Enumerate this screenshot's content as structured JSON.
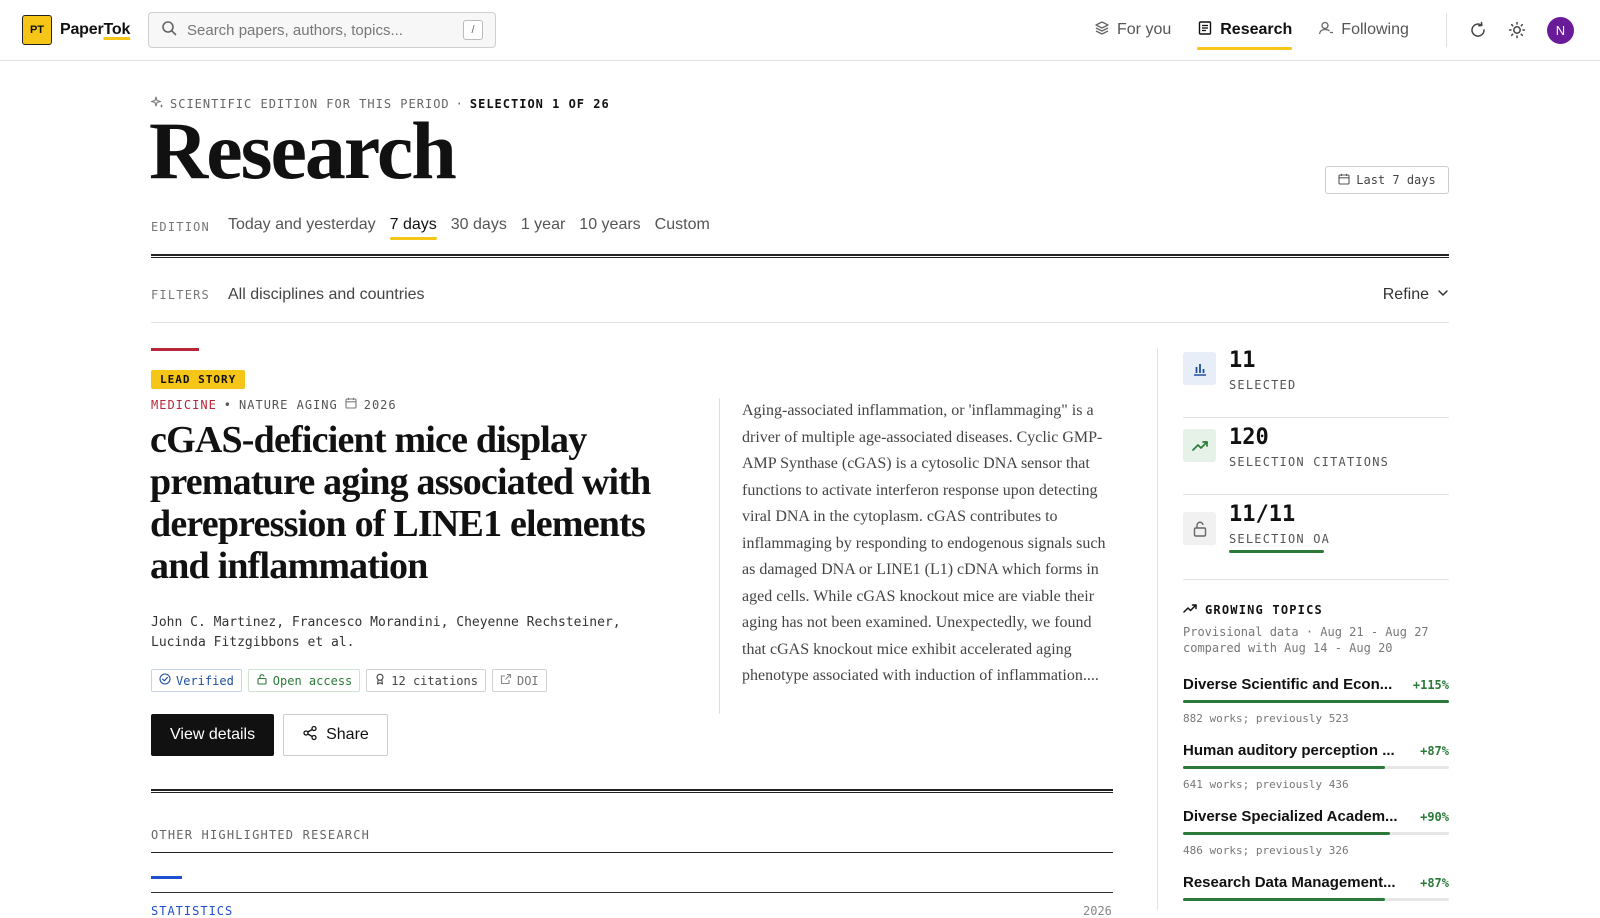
{
  "brand": {
    "badge": "PT",
    "name_a": "Paper",
    "name_b": "Tok"
  },
  "search": {
    "placeholder": "Search papers, authors, topics...",
    "shortcut": "/"
  },
  "nav": [
    {
      "label": "For you",
      "icon": "layers-icon",
      "active": false
    },
    {
      "label": "Research",
      "icon": "newspaper-icon",
      "active": true
    },
    {
      "label": "Following",
      "icon": "user-icon",
      "active": false
    }
  ],
  "user": {
    "initial": "N",
    "color": "#6a1b9a"
  },
  "edition": {
    "kicker": "SCIENTIFIC EDITION FOR THIS PERIOD",
    "separator": "·",
    "selection": "SELECTION 1 OF 26",
    "title": "Research",
    "range_button": "Last 7 days",
    "label": "EDITION",
    "options": [
      "Today and yesterday",
      "7 days",
      "30 days",
      "1 year",
      "10 years",
      "Custom"
    ],
    "active_option": "7 days"
  },
  "filters": {
    "label": "FILTERS",
    "value": "All disciplines and countries",
    "refine": "Refine"
  },
  "lead": {
    "badge": "LEAD STORY",
    "subject": "MEDICINE",
    "dot": "•",
    "journal": "NATURE AGING",
    "year": "2026",
    "title": "cGAS-deficient mice display premature aging associated with derepression of LINE1 elements and inflammation",
    "authors": "John C. Martinez, Francesco Morandini, Cheyenne Rechsteiner, Lucinda Fitzgibbons et al.",
    "badges": {
      "verified": "Verified",
      "open_access": "Open access",
      "citations": "12 citations",
      "doi": "DOI"
    },
    "view_details": "View details",
    "share": "Share",
    "abstract": "Aging-associated inflammation, or 'inflammaging\" is a driver of multiple age-associated diseases. Cyclic GMP-AMP Synthase (cGAS) is a cytosolic DNA sensor that functions to activate interferon response upon detecting viral DNA in the cytoplasm. cGAS contributes to inflammaging by responding to endogenous signals such as damaged DNA or LINE1 (L1) cDNA which forms in aged cells. While cGAS knockout mice are viable their aging has not been examined. Unexpectedly, we found that cGAS knockout mice exhibit accelerated aging phenotype associated with induction of inflammation...."
  },
  "other": {
    "label": "OTHER HIGHLIGHTED RESEARCH",
    "peek_subject": "STATISTICS",
    "peek_year": "2026"
  },
  "stats": [
    {
      "value": "11",
      "label": "SELECTED",
      "icon": "bar-chart-icon",
      "color": "#1e4fa0",
      "bg": "#e8eef8"
    },
    {
      "value": "120",
      "label": "SELECTION CITATIONS",
      "icon": "trending-up-icon",
      "color": "#2b7a3a",
      "bg": "#e6f2e8"
    },
    {
      "value": "11/11",
      "label": "SELECTION OA",
      "icon": "unlock-icon",
      "color": "#666666",
      "bg": "#f1f1f1",
      "oa_fraction": 1.0
    }
  ],
  "growing": {
    "title": "GROWING TOPICS",
    "note_line1": "Provisional data · Aug 21 - Aug 27",
    "note_line2": "compared with Aug 14 - Aug 20",
    "topics": [
      {
        "name": "Diverse Scientific and Econ...",
        "pct": "+115%",
        "sub": "882 works; previously 523",
        "fill": 1.0
      },
      {
        "name": "Human auditory perception ...",
        "pct": "+87%",
        "sub": "641 works; previously 436",
        "fill": 0.76
      },
      {
        "name": "Diverse Specialized Academ...",
        "pct": "+90%",
        "sub": "486 works; previously 326",
        "fill": 0.78
      },
      {
        "name": "Research Data Management...",
        "pct": "+87%",
        "sub": "",
        "fill": 0.76
      }
    ]
  },
  "colors": {
    "accent": "#f5c518",
    "lead_accent": "#b5283c",
    "positive": "#2b7a3a",
    "link_blue": "#1e4fd0"
  }
}
